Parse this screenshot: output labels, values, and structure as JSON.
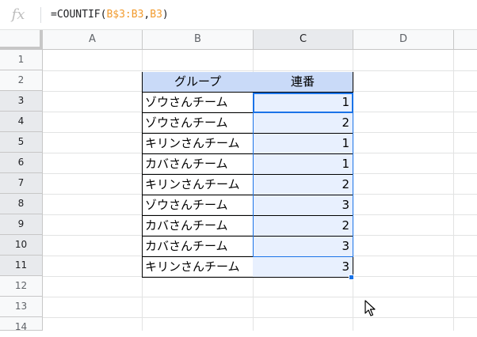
{
  "formula_bar": {
    "fx_label": "fx",
    "formula_prefix": "=COUNTIF(",
    "formula_ref1": "B$3:B3",
    "formula_comma": ",",
    "formula_ref2": "B3",
    "formula_suffix": ")"
  },
  "columns": [
    "A",
    "B",
    "C",
    "D"
  ],
  "rows": [
    "1",
    "2",
    "3",
    "4",
    "5",
    "6",
    "7",
    "8",
    "9",
    "10",
    "11",
    "12",
    "13",
    "14"
  ],
  "table": {
    "headers": [
      "グループ",
      "連番"
    ],
    "data": [
      {
        "group": "ゾウさんチーム",
        "num": "1"
      },
      {
        "group": "ゾウさんチーム",
        "num": "2"
      },
      {
        "group": "キリンさんチーム",
        "num": "1"
      },
      {
        "group": "カバさんチーム",
        "num": "1"
      },
      {
        "group": "キリンさんチーム",
        "num": "2"
      },
      {
        "group": "ゾウさんチーム",
        "num": "3"
      },
      {
        "group": "カバさんチーム",
        "num": "2"
      },
      {
        "group": "カバさんチーム",
        "num": "3"
      },
      {
        "group": "キリンさんチーム",
        "num": "3"
      }
    ]
  },
  "colors": {
    "header_fill": "#c9daf8",
    "selection_fill": "#e8f0fe",
    "selection_border": "#1a73e8",
    "formula_ref": "#f29b2e"
  },
  "icons": {
    "cursor": "mouse-pointer-icon"
  }
}
